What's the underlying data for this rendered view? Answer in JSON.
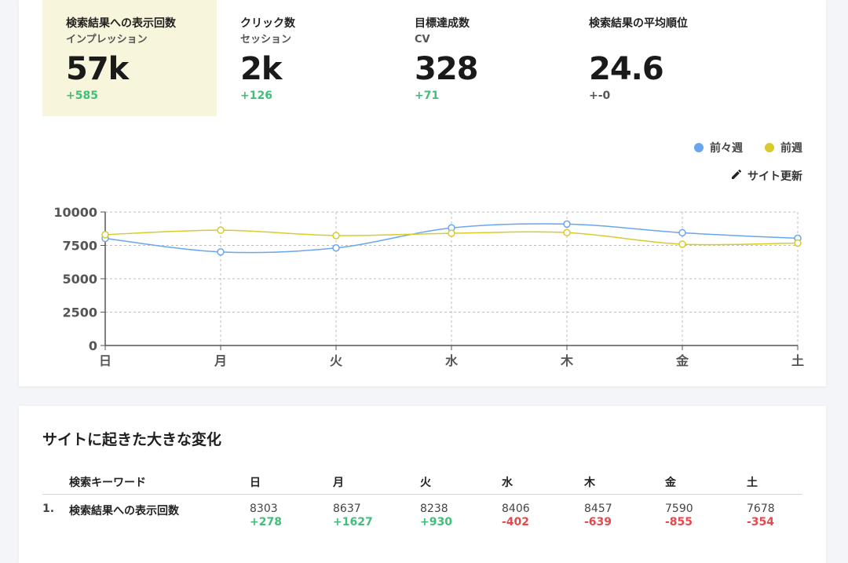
{
  "metrics": [
    {
      "title": "検索結果への表示回数",
      "sub": "インプレッション",
      "value": "57k",
      "delta": "+585",
      "delta_kind": "pos",
      "active": true
    },
    {
      "title": "クリック数",
      "sub": "セッション",
      "value": "2k",
      "delta": "+126",
      "delta_kind": "pos",
      "active": false
    },
    {
      "title": "目標達成数",
      "sub": "CV",
      "value": "328",
      "delta": "+71",
      "delta_kind": "pos",
      "active": false
    },
    {
      "title": "検索結果の平均順位",
      "sub": "",
      "value": "24.6",
      "delta": "+-0",
      "delta_kind": "neutral",
      "active": false
    }
  ],
  "legend": {
    "prev_prev_week": "前々週",
    "prev_week": "前週"
  },
  "update_label": "サイト更新",
  "colors": {
    "blue": "#6aa6ee",
    "yellow": "#d8cb2c",
    "positive": "#3fbf78",
    "negative": "#e5484d"
  },
  "chart_data": {
    "type": "line",
    "categories": [
      "日",
      "月",
      "火",
      "水",
      "木",
      "金",
      "土"
    ],
    "ylim": [
      0,
      10000
    ],
    "yticks": [
      0,
      2500,
      5000,
      7500,
      10000
    ],
    "grid": true,
    "legend_position": "top-right",
    "series": [
      {
        "name": "前々週",
        "color": "#6aa6ee",
        "values": [
          8025,
          7010,
          7308,
          8808,
          9096,
          8445,
          8032
        ]
      },
      {
        "name": "前週",
        "color": "#d8cb2c",
        "values": [
          8303,
          8637,
          8238,
          8406,
          8457,
          7590,
          7678
        ]
      }
    ]
  },
  "changes": {
    "title": "サイトに起きた大きな変化",
    "header": {
      "keyword": "検索キーワード",
      "days": [
        "日",
        "月",
        "火",
        "水",
        "木",
        "金",
        "土"
      ]
    },
    "rows": [
      {
        "rank": "1.",
        "keyword": "検索結果への表示回数",
        "cells": [
          {
            "value": "8303",
            "delta": "+278",
            "kind": "pos"
          },
          {
            "value": "8637",
            "delta": "+1627",
            "kind": "pos"
          },
          {
            "value": "8238",
            "delta": "+930",
            "kind": "pos"
          },
          {
            "value": "8406",
            "delta": "-402",
            "kind": "neg"
          },
          {
            "value": "8457",
            "delta": "-639",
            "kind": "neg"
          },
          {
            "value": "7590",
            "delta": "-855",
            "kind": "neg"
          },
          {
            "value": "7678",
            "delta": "-354",
            "kind": "neg"
          }
        ]
      }
    ]
  }
}
